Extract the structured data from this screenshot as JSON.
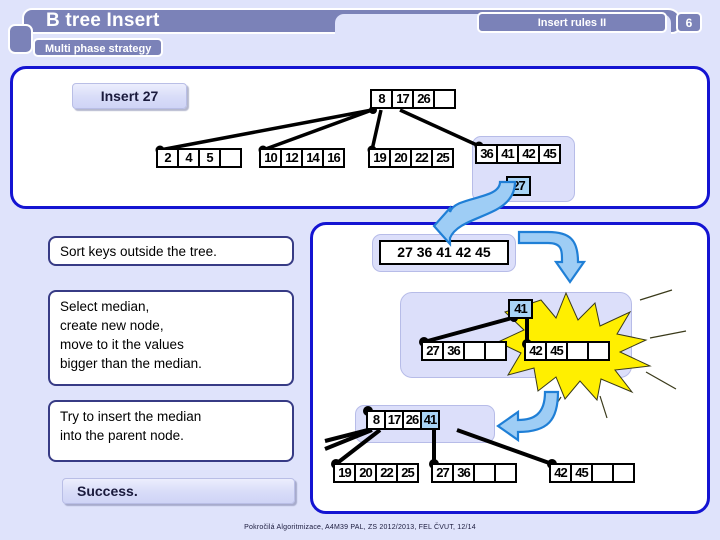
{
  "header": {
    "title": "B tree Insert",
    "subtitle": "Multi phase strategy",
    "chapter": "Insert rules II",
    "slide_number": "6"
  },
  "callouts": {
    "insert": "Insert 27",
    "success": "Success."
  },
  "steps": [
    {
      "text": "Sort keys outside the tree."
    },
    {
      "line1": "Select median,",
      "line2": "create new node,",
      "line3": "move to it the values",
      "line4": "bigger than the median."
    },
    {
      "line1": "Try to insert the median",
      "line2": "into the parent node."
    }
  ],
  "tree_before": {
    "root": {
      "keys": [
        "8",
        "17",
        "26",
        ""
      ]
    },
    "leaves": [
      {
        "keys": [
          "2",
          "4",
          "5",
          ""
        ]
      },
      {
        "keys": [
          "10",
          "12",
          "14",
          "16"
        ]
      },
      {
        "keys": [
          "19",
          "20",
          "22",
          "25"
        ]
      },
      {
        "keys": [
          "36",
          "41",
          "42",
          "45"
        ]
      }
    ],
    "inserted_key": "27"
  },
  "sorted_keys": "27 36 41 42 45",
  "split": {
    "median": "41",
    "left_node": {
      "keys": [
        "27",
        "36",
        "",
        ""
      ]
    },
    "right_node": {
      "keys": [
        "42",
        "45",
        "",
        ""
      ]
    }
  },
  "tree_after": {
    "root": {
      "keys": [
        "8",
        "17",
        "26",
        "41"
      ]
    },
    "leaves": [
      {
        "keys": [
          "19",
          "20",
          "22",
          "25"
        ]
      },
      {
        "keys": [
          "27",
          "36",
          "",
          ""
        ]
      },
      {
        "keys": [
          "42",
          "45",
          "",
          ""
        ]
      }
    ]
  },
  "colors": {
    "header_bar": "#7b82b8",
    "page_background": "#dfe3fb",
    "panel_border": "#1414d2",
    "highlight_key": "#a8d4f5",
    "burst": "#ffef00",
    "arrow": "#3399ee"
  },
  "footer": "Pokročilá Algoritmizace, A4M39 PAL, ZS 2012/2013, FEL ČVUT,  12/14"
}
